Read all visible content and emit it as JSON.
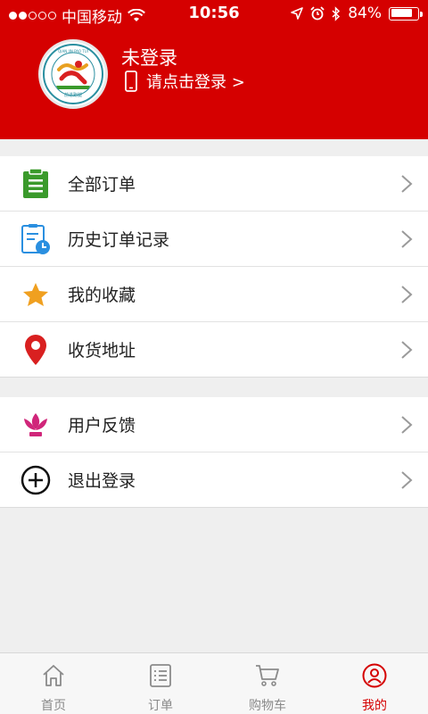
{
  "status_bar": {
    "carrier": "中国移动",
    "time": "10:56",
    "battery": "84%",
    "battery_level": 0.84
  },
  "profile": {
    "name": "未登录",
    "login_prompt": "请点击登录 >",
    "logo_text": "QIAN JIN PAO TUI",
    "logo_label": "前进跑腿"
  },
  "menu_groups": [
    {
      "items": [
        {
          "label": "全部订单",
          "icon": "clipboard-icon",
          "color": "#3a9a2b"
        },
        {
          "label": "历史订单记录",
          "icon": "history-list-icon",
          "color": "#2a8fe0"
        },
        {
          "label": "我的收藏",
          "icon": "star-icon",
          "color": "#f0a020"
        },
        {
          "label": "收货地址",
          "icon": "location-pin-icon",
          "color": "#d92020"
        }
      ]
    },
    {
      "items": [
        {
          "label": "用户反馈",
          "icon": "lotus-icon",
          "color": "#d0267a"
        },
        {
          "label": "退出登录",
          "icon": "plus-circle-icon",
          "color": "#111111"
        }
      ]
    }
  ],
  "tabs": [
    {
      "label": "首页",
      "icon": "home-icon",
      "active": false
    },
    {
      "label": "订单",
      "icon": "order-list-icon",
      "active": false
    },
    {
      "label": "购物车",
      "icon": "cart-icon",
      "active": false
    },
    {
      "label": "我的",
      "icon": "user-icon",
      "active": true
    }
  ],
  "colors": {
    "brand_red": "#d50000",
    "active_tab": "#d50000",
    "inactive_tab": "#8a8a8a"
  }
}
